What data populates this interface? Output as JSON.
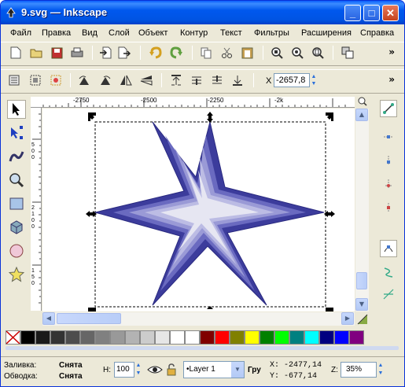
{
  "window": {
    "title": "9.svg — Inkscape",
    "controls": {
      "minimize": "_",
      "maximize": "□",
      "close": "✕"
    }
  },
  "menu": [
    "Файл",
    "Правка",
    "Вид",
    "Слой",
    "Объект",
    "Контур",
    "Текст",
    "Фильтры",
    "Расширения",
    "Справка"
  ],
  "toolbar_more": "»",
  "tool_controls": {
    "x_label": "X",
    "x_value": "-2657,8"
  },
  "ruler": {
    "h_labels": [
      "-2750",
      "-2500",
      "-2250",
      "-2k"
    ],
    "v_labels": [
      "5",
      "0",
      "0",
      "2",
      "1",
      "0",
      "0",
      "1",
      "5",
      "0"
    ]
  },
  "palette_colors": [
    "#000000",
    "#1a1a1a",
    "#333333",
    "#4d4d4d",
    "#666666",
    "#808080",
    "#999999",
    "#b3b3b3",
    "#cccccc",
    "#e6e6e6",
    "#ffffff",
    "#ffffff",
    "#800000",
    "#ff0000",
    "#808000",
    "#ffff00",
    "#008000",
    "#00ff00",
    "#008080",
    "#00ffff",
    "#000080",
    "#0000ff",
    "#800080"
  ],
  "status": {
    "fill_label": "Заливка:",
    "fill_value": "Снята",
    "stroke_label": "Обводка:",
    "stroke_value": "Снята",
    "h_label": "H:",
    "h_value": "100",
    "layer_value": "•Layer 1",
    "group_label": "Гру",
    "x_coord": "X: -2477,14",
    "y_coord": "Y:  -677,14",
    "zoom_label": "Z:",
    "zoom_value": "35%"
  },
  "colors": {
    "title_blue": "#0054e3",
    "star_outer": "#3f3fa0",
    "star_inner": "#e8e8f0"
  }
}
